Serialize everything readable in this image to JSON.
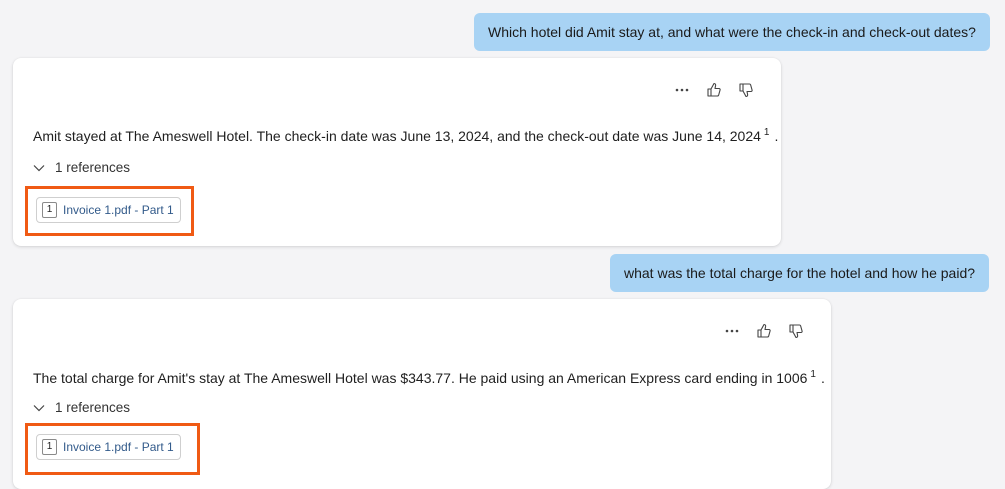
{
  "conversation": [
    {
      "user_message": "Which hotel did Amit stay at, and what were the check-in and check-out dates?",
      "answer": "Amit stayed at The Ameswell Hotel. The check-in date was June 13, 2024, and the check-out date was June 14, 2024",
      "citation": "1",
      "answer_end": ".",
      "references_toggle": "1 references",
      "reference_chip": {
        "number": "1",
        "label": "Invoice 1.pdf - Part 1"
      }
    },
    {
      "user_message": "what was the total charge for the hotel and how he paid?",
      "answer": "The total charge for Amit's stay at The Ameswell Hotel was $343.77. He paid using an American Express card ending in 1006",
      "citation": "1",
      "answer_end": ".",
      "references_toggle": "1 references",
      "reference_chip": {
        "number": "1",
        "label": "Invoice 1.pdf - Part 1"
      }
    }
  ],
  "icons": {
    "more": "more-options-icon",
    "like": "thumbs-up-icon",
    "dislike": "thumbs-down-icon",
    "expand": "chevron-down-icon"
  },
  "colors": {
    "user_bubble": "#a8d3f4",
    "highlight": "#f05a14",
    "reference_link": "#325a8a",
    "background": "#f4f4f6"
  }
}
